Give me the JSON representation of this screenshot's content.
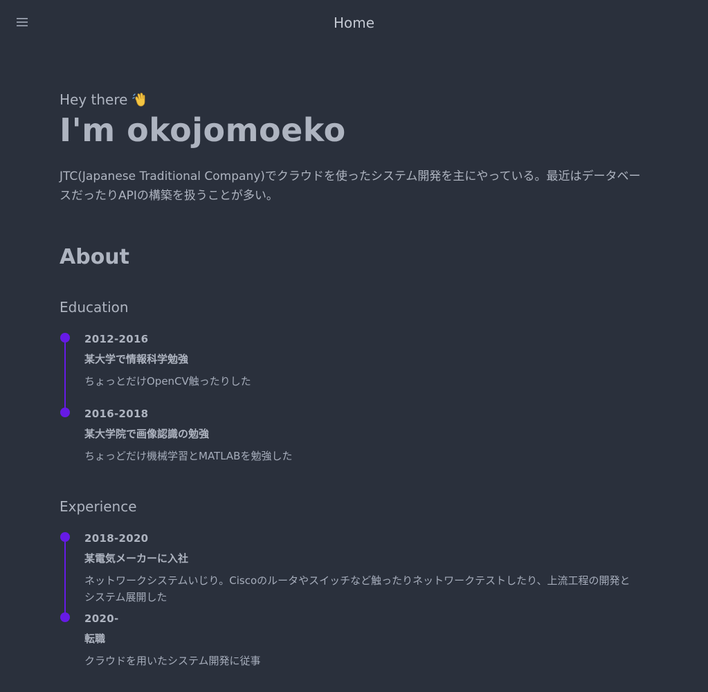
{
  "header": {
    "title": "Home",
    "menu_icon": "hamburger-menu-icon"
  },
  "hero": {
    "greeting": "Hey there",
    "greeting_icon": "waving-hand-icon",
    "name": "I'm okojomoeko",
    "intro": "JTC(Japanese Traditional Company)でクラウドを使ったシステム開発を主にやっている。最近はデータベースだったりAPIの構築を扱うことが多い。"
  },
  "about": {
    "heading": "About",
    "education": {
      "heading": "Education",
      "items": [
        {
          "date": "2012-2016",
          "title": "某大学で情報科学勉強",
          "description": "ちょっとだけOpenCV触ったりした"
        },
        {
          "date": "2016-2018",
          "title": "某大学院で画像認識の勉強",
          "description": "ちょっどだけ機械学習とMATLABを勉強した"
        }
      ]
    },
    "experience": {
      "heading": "Experience",
      "items": [
        {
          "date": "2018-2020",
          "title": "某電気メーカーに入社",
          "description": "ネットワークシステムいじり。Ciscoのルータやスイッチなど触ったりネットワークテストしたり、上流工程の開発とシステム展開した"
        },
        {
          "date": "2020-",
          "title": "転職",
          "description": "クラウドを用いたシステム開発に従事"
        }
      ]
    }
  },
  "colors": {
    "background": "#2a303c",
    "text": "#a6adbb",
    "accent": "#661ae6"
  }
}
